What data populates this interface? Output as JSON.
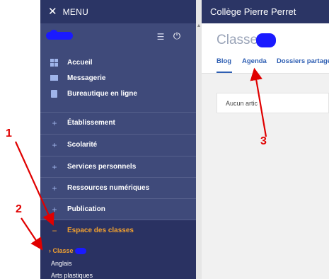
{
  "menu": {
    "close_glyph": "✕",
    "label": "MENU"
  },
  "user": {
    "settings_glyph": "☰",
    "power_glyph": "⏻"
  },
  "nav": [
    {
      "icon": "apps-grid-icon",
      "label": "Accueil"
    },
    {
      "icon": "mail-icon",
      "label": "Messagerie"
    },
    {
      "icon": "office-icon",
      "label": "Bureautique en ligne"
    }
  ],
  "sections": [
    {
      "symbol": "+",
      "label": "Établissement"
    },
    {
      "symbol": "+",
      "label": "Scolarité"
    },
    {
      "symbol": "+",
      "label": "Services personnels"
    },
    {
      "symbol": "+",
      "label": "Ressources numériques"
    },
    {
      "symbol": "+",
      "label": "Publication"
    },
    {
      "symbol": "−",
      "label": "Espace des classes"
    }
  ],
  "subitems": [
    {
      "label": "Classe",
      "marker": "›"
    },
    {
      "label": "Anglais"
    },
    {
      "label": "Arts plastiques"
    }
  ],
  "header": {
    "school": "Collège Pierre Perret"
  },
  "page": {
    "title": "Classe"
  },
  "tabs": [
    {
      "label": "Blog"
    },
    {
      "label": "Agenda"
    },
    {
      "label": "Dossiers partagé"
    }
  ],
  "card": {
    "text": "Aucun artic"
  },
  "annotations": [
    {
      "label": "1"
    },
    {
      "label": "2"
    },
    {
      "label": "3"
    }
  ],
  "colors": {
    "sidebar": "#3f4a7a",
    "header": "#2b3565",
    "active": "#f0a030",
    "link": "#2f5fb3",
    "annotation": "#e00000"
  }
}
